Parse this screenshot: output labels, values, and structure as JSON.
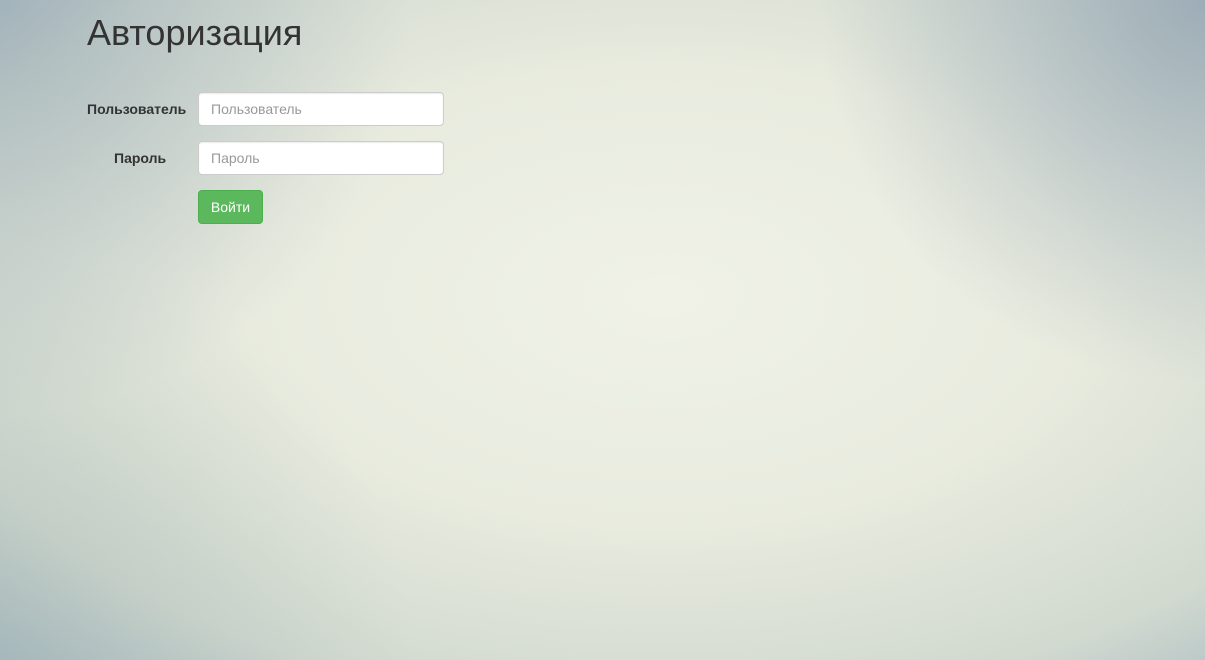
{
  "page": {
    "title": "Авторизация"
  },
  "form": {
    "username": {
      "label": "Пользователь",
      "placeholder": "Пользователь",
      "value": ""
    },
    "password": {
      "label": "Пароль",
      "placeholder": "Пароль",
      "value": ""
    },
    "submit_label": "Войти"
  },
  "colors": {
    "primary_button": "#5cb85c",
    "text": "#333333"
  }
}
